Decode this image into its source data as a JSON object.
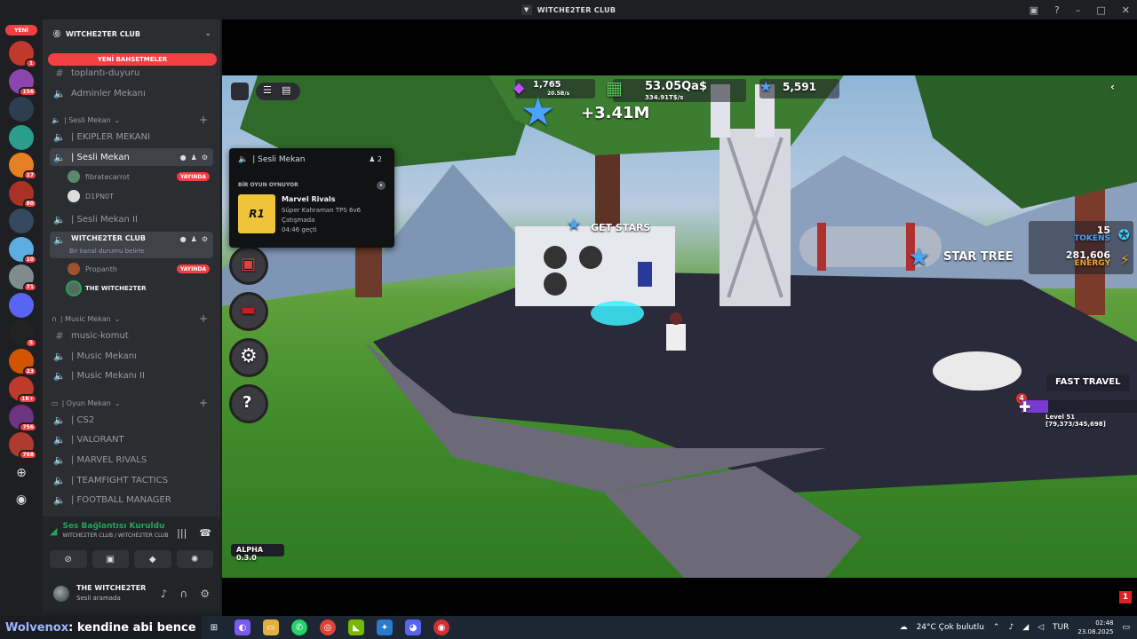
{
  "window": {
    "title": "WITCHE2TER CLUB"
  },
  "rail": {
    "new_label": "YENİ",
    "servers": [
      {
        "badge": "1",
        "color": "#c0392b"
      },
      {
        "badge": "156",
        "color": "#8e44ad"
      },
      {
        "badge": "",
        "color": "#2c3e50"
      },
      {
        "badge": "",
        "color": "#2a9d8f"
      },
      {
        "badge": "17",
        "color": "#e67e22"
      },
      {
        "badge": "80",
        "color": "#a93226"
      },
      {
        "badge": "",
        "color": "#34495e"
      },
      {
        "badge": "10",
        "color": "#5dade2"
      },
      {
        "badge": "71",
        "color": "#7f8c8d"
      },
      {
        "badge": "",
        "color": "#5865f2"
      },
      {
        "badge": "5",
        "color": "#222222"
      },
      {
        "badge": "23",
        "color": "#d35400"
      },
      {
        "badge": "1K+",
        "color": "#c0392b"
      },
      {
        "badge": "756",
        "color": "#6c3483"
      },
      {
        "badge": "768",
        "color": "#b03a2e"
      }
    ]
  },
  "guild": {
    "name": "WITCHE2TER CLUB",
    "mentions_label": "YENİ BAHSETMELER",
    "channels_top": [
      {
        "name": "toplantı-duyuru",
        "icon": "text"
      },
      {
        "name": "Adminler Mekanı",
        "icon": "voice"
      }
    ],
    "categories": {
      "sesli": "| Sesli Mekan",
      "music": "| Music Mekan",
      "oyun": "| Oyun Mekan"
    },
    "sesli_channels": {
      "ekipler": "| EKIPLER MEKANI",
      "sesli_mekan": "| Sesli Mekan",
      "sesli_mekan_2": "| Sesli Mekan II",
      "witchezter": "WITCHE2TER CLUB",
      "witchezter_note": "Bir kanal durumu belirle"
    },
    "voice_users": [
      {
        "name": "fibratecarrot",
        "live": "YAYINDA"
      },
      {
        "name": "D1PN0T",
        "live": ""
      },
      {
        "name": "Propanth",
        "live": "YAYINDA"
      },
      {
        "name": "THE WITCHE2TER",
        "live": ""
      }
    ],
    "music_channels": [
      "music-komut",
      "| Music Mekanı",
      "| Music Mekanı II"
    ],
    "oyun_channels": [
      "| CS2",
      "| VALORANT",
      "| MARVEL RIVALS",
      "| TEAMFIGHT TACTICS",
      "| FOOTBALL MANAGER"
    ]
  },
  "voice_panel": {
    "status": "Ses Bağlantısı Kuruldu",
    "location": "WITCHE2TER CLUB / WITCHE2TER CLUB"
  },
  "user_panel": {
    "name": "THE WITCHE2TER",
    "status": "Sesli aramada"
  },
  "popup": {
    "channel": "| Sesli Mekan",
    "count": "2",
    "section": "BİR OYUN OYNUYOR",
    "game_title": "Marvel Rivals",
    "game_logo": "R1",
    "line1": "Süper Kahraman TPS 6v6",
    "line2": "Çatışmada",
    "line3": "04:46 geçti"
  },
  "game_hud": {
    "gems": "1,765",
    "gems_rate": "20.5B/s",
    "cash": "53.05Qa$",
    "cash_rate": "334.91T$/s",
    "stars": "5,591",
    "star_gain": "+3.41M",
    "get_stars": "GET STARS",
    "star_tree": "STAR TREE",
    "tokens_value": "15",
    "tokens_label": "TOKENS",
    "energy_value": "281,606",
    "energy_label": "ENERGY",
    "fast_travel": "FAST TRAVEL",
    "level_badge": "4",
    "level_text": "Level 51 [79,373/345,698]",
    "level_progress": 0.23,
    "version": "ALPHA 0.3.0"
  },
  "taskbar": {
    "ticker_user": "Wolvenox",
    "ticker_msg": ": kendine abi bence",
    "weather": "24°C  Çok bulutlu",
    "lang": "TUR",
    "time": "02:48",
    "date": "23.08.2025"
  }
}
